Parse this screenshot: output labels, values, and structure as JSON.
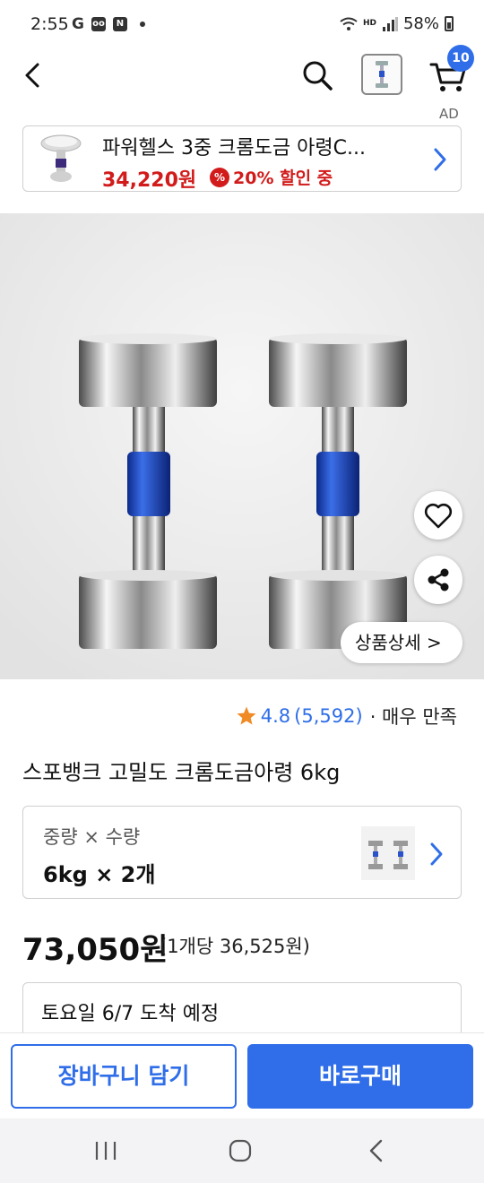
{
  "status_bar": {
    "time": "2:55",
    "battery": "58%",
    "volte": "HD",
    "icons": [
      "google-icon",
      "voicemail-icon",
      "n-icon",
      "dot-icon"
    ]
  },
  "top_nav": {
    "cart_count": "10",
    "ad_label": "AD"
  },
  "ad_card": {
    "title": "파워헬스 3중 크롬도금 아령C...",
    "price": "34,220원",
    "discount": "20% 할인 중"
  },
  "hero": {
    "detail_label": "상품상세 >"
  },
  "rating": {
    "score": "4.8",
    "count": "(5,592)",
    "satisfaction": "· 매우 만족"
  },
  "product": {
    "name": "스포뱅크 고밀도 크롬도금아령 6kg",
    "option_label": "중량 × 수량",
    "option_value": "6kg × 2개",
    "price": "73,050원",
    "unit_price": "(1개당 36,525원)",
    "delivery": "토요일 6/7 도착 예정"
  },
  "actions": {
    "cart_button": "장바구니 담기",
    "buy_button": "바로구매"
  },
  "colors": {
    "accent": "#2f6ee8",
    "sale": "#d21b1b",
    "star": "#f08a24"
  }
}
